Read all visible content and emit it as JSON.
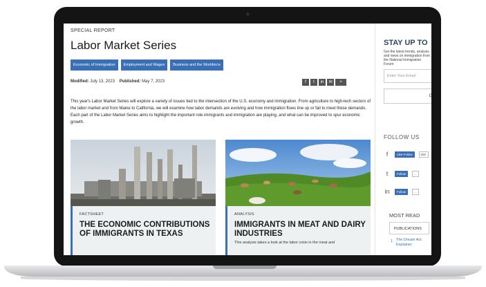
{
  "article": {
    "eyebrow": "SPECIAL REPORT",
    "title": "Labor Market Series",
    "tags": [
      "Economic of Immigration",
      "Employment and Wages",
      "Business and the Workforce"
    ],
    "modified_label": "Modified:",
    "modified_date": "July 13, 2023",
    "published_label": "Published:",
    "published_date": "May 7, 2023",
    "share_icons": [
      "f",
      "t",
      "in",
      "✉",
      "+"
    ],
    "intro": "This year's Labor Market Series will explore a variety of issues tied to the intersection of the U.S. economy and immigration. From agriculture to high-tech sectors of the labor market and from Maine to California, we will examine how labor demands are evolving and how immigration flows line up or fail to meet these demands. Each part of the Labor Market Series aims to highlight the important role immigrants and immigration are playing, and what can be improved to spur economic growth."
  },
  "cards": [
    {
      "kicker": "FACTSHEET",
      "title": "THE ECONOMIC CONTRIBUTIONS OF IMMIGRANTS IN TEXAS",
      "desc": ""
    },
    {
      "kicker": "ANALYSIS",
      "title": "IMMIGRANTS IN MEAT AND DAIRY INDUSTRIES",
      "desc": "This analysis takes a look at the labor crisis in the meat and"
    }
  ],
  "rail": {
    "stay_title": "STAY UP TO",
    "stay_sub": "Get the latest trends, analysis and news on immigration from the National Immigration Forum",
    "email_placeholder": "Enter Your Email",
    "go_label": "GO",
    "follow_label": "FOLLOW US",
    "social": [
      {
        "icon": "f",
        "button": "Like Follow",
        "count": "55K"
      },
      {
        "icon": "t",
        "button": "Follow",
        "count": "..."
      },
      {
        "icon": "in",
        "button": "Follow",
        "count": "..."
      }
    ],
    "most_read_label": "MOST READ",
    "publications_tab": "PUBLICATIONS",
    "most_read_num": "1",
    "most_read_item": "The Dream Act Explainer"
  }
}
